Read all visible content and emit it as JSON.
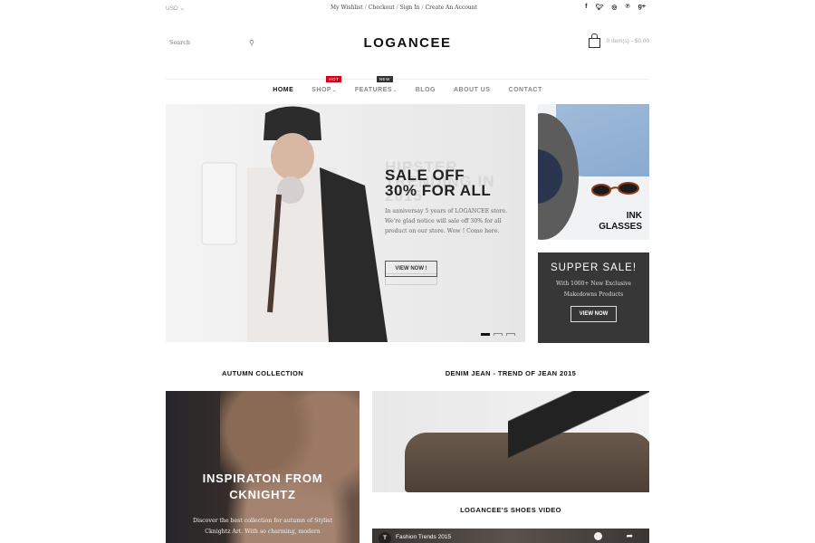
{
  "topbar": {
    "currency": "USD",
    "links": [
      "My Wishlist",
      "Checkout",
      "Sign In",
      "Create An Account"
    ],
    "separator": "/",
    "social": [
      "f",
      "t",
      "i",
      "p",
      "g+"
    ]
  },
  "header": {
    "search_placeholder": "Search",
    "logo": "LOGANCEE",
    "cart_text": "0 item(s) - $0.00"
  },
  "nav": {
    "items": [
      {
        "label": "HOME",
        "active": true
      },
      {
        "label": "SHOP",
        "badge": "HOT",
        "dropdown": true
      },
      {
        "label": "FEATURES",
        "badge": "NEW",
        "dropdown": true
      },
      {
        "label": "BLOG"
      },
      {
        "label": "ABOUT US"
      },
      {
        "label": "CONTACT"
      }
    ]
  },
  "hero": {
    "ghost_title": "HIPSTER TRENDING IN 2015",
    "title_line1": "SALE OFF",
    "title_line2": "30% FOR ALL",
    "body": "In anniversay 5 years of LOGANCEE store. We're glad notice will sale off 30% for all product on our store. Wow ! Come here.",
    "button": "VIEW NOW !",
    "slides_total": 3,
    "slide_active": 1
  },
  "side_banner1": {
    "line1": "INK",
    "line2": "GLASSES"
  },
  "side_banner2": {
    "title": "SUPPER SALE!",
    "line1": "With 1000+ New Exclusive",
    "line2": "Makedowns Products",
    "button": "VIEW NOW"
  },
  "sections": {
    "autumn_title": "AUTUMN COLLECTION",
    "denim_title": "DENIM JEAN - TREND OF JEAN 2015",
    "video_title": "LOGANCEE'S SHOES VIDEO"
  },
  "autumn": {
    "heading_line1": "INSPIRATON FROM",
    "heading_line2": "CKNIGHTZ",
    "text_line1": "Discover the best collection for autumn of Stylist",
    "text_line2": "Cknightz Art. With so charming, modern"
  },
  "video": {
    "channel_initial": "T",
    "title": "Fashion Trends 2015"
  }
}
